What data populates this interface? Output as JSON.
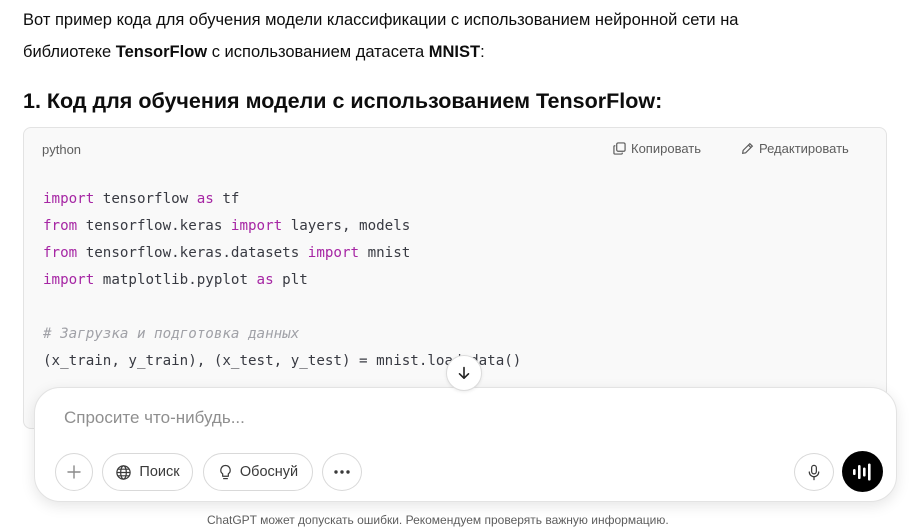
{
  "message": {
    "intro_line1": "Вот пример кода для обучения модели классификации с использованием нейронной сети на",
    "intro_line2_prefix": "библиотеке ",
    "intro_line2_bold1": "TensorFlow",
    "intro_line2_middle": " с использованием датасета ",
    "intro_line2_bold2": "MNIST",
    "intro_line2_suffix": ":",
    "heading_prefix": "1. Код для обучения модели с использованием ",
    "heading_bold": "TensorFlow",
    "heading_suffix": ":"
  },
  "code_block": {
    "language": "python",
    "copy_label": "Копировать",
    "edit_label": "Редактировать",
    "lines": {
      "l1_kw": "import",
      "l1_a": " tensorflow ",
      "l1_kw2": "as",
      "l1_b": " tf",
      "l2_kw": "from",
      "l2_a": " tensorflow.keras ",
      "l2_kw2": "import",
      "l2_b": " layers, models",
      "l3_kw": "from",
      "l3_a": " tensorflow.keras.datasets ",
      "l3_kw2": "import",
      "l3_b": " mnist",
      "l4_kw": "import",
      "l4_a": " matplotlib.pyplot ",
      "l4_kw2": "as",
      "l4_b": " plt",
      "l6_comment": "# Загрузка и подготовка данных",
      "l7": "(x_train, y_train), (x_test, y_test) = mnist.load_data()"
    }
  },
  "composer": {
    "placeholder": "Спросите что-нибудь...",
    "search_label": "Поиск",
    "reason_label": "Обоснуй"
  },
  "footer": {
    "note": "ChatGPT может допускать ошибки. Рекомендуем проверять важную информацию."
  },
  "icons": {
    "copy": "copy-icon",
    "edit": "pen-icon",
    "scroll": "arrow-down-icon",
    "plus": "plus-icon",
    "globe": "globe-icon",
    "bulb": "lightbulb-icon",
    "more": "ellipsis-icon",
    "mic": "microphone-icon",
    "voice": "waveform-icon"
  }
}
